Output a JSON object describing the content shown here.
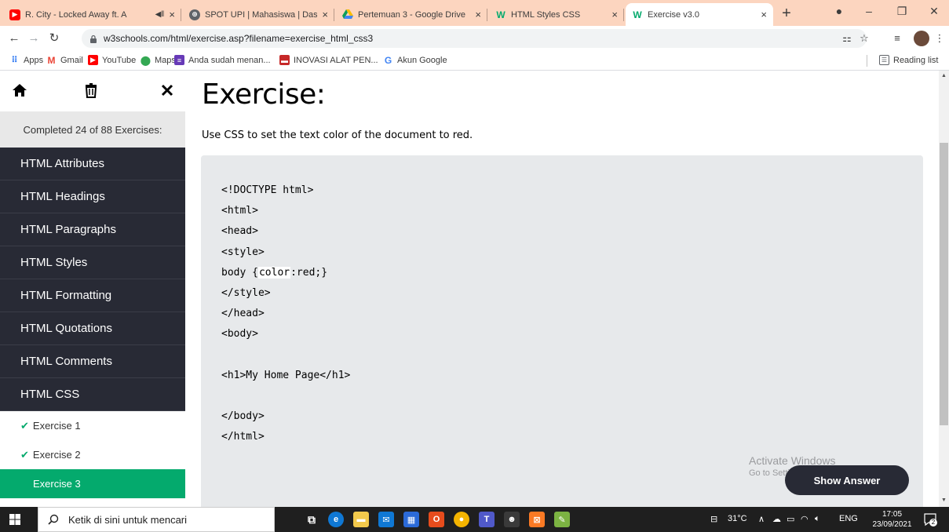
{
  "browser": {
    "tabs": [
      {
        "title": "R. City - Locked Away ft. A",
        "icon": "youtube-icon",
        "close": "×"
      },
      {
        "title": "SPOT UPI | Mahasiswa | Dashb",
        "icon": "globe-icon",
        "close": "×"
      },
      {
        "title": "Pertemuan 3 - Google Drive",
        "icon": "drive-icon",
        "close": "×"
      },
      {
        "title": "HTML Styles CSS",
        "icon": "w3schools-icon",
        "close": "×"
      },
      {
        "title": "Exercise v3.0",
        "icon": "w3schools-icon",
        "close": "×",
        "active": true
      }
    ],
    "new_tab": "+",
    "url": "w3schools.com/html/exercise.asp?filename=exercise_html_css3",
    "bookmarks": [
      {
        "label": "Apps",
        "icon": "apps-grid-icon"
      },
      {
        "label": "Gmail",
        "icon": "gmail-icon"
      },
      {
        "label": "YouTube",
        "icon": "youtube-icon"
      },
      {
        "label": "Maps",
        "icon": "maps-icon"
      },
      {
        "label": "Anda sudah menan...",
        "icon": "forms-icon"
      },
      {
        "label": "INOVASI ALAT PEN...",
        "icon": "folder-icon"
      },
      {
        "label": "Akun Google",
        "icon": "google-icon"
      }
    ],
    "reading_list": "Reading list"
  },
  "sidebar": {
    "progress": "Completed 24 of 88 Exercises:",
    "sections": [
      {
        "label": "HTML Attributes"
      },
      {
        "label": "HTML Headings"
      },
      {
        "label": "HTML Paragraphs"
      },
      {
        "label": "HTML Styles"
      },
      {
        "label": "HTML Formatting"
      },
      {
        "label": "HTML Quotations"
      },
      {
        "label": "HTML Comments"
      },
      {
        "label": "HTML CSS"
      }
    ],
    "exercises": [
      {
        "label": "Exercise 1",
        "completed": true
      },
      {
        "label": "Exercise 2",
        "completed": true
      },
      {
        "label": "Exercise 3",
        "completed": false,
        "active": true
      }
    ]
  },
  "main": {
    "title": "Exercise:",
    "instruction": "Use CSS to set the text color of the document to red.",
    "code": {
      "l1": "<!DOCTYPE html>",
      "l2": "<html>",
      "l3": "<head>",
      "l4": "<style>",
      "l5_pre": "body {",
      "l5_answer": "color",
      "l5_post": ":red;}",
      "l6": "</style>",
      "l7": "</head>",
      "l8": "<body>",
      "l9": "<h1>My Home Page</h1>",
      "l10": "</body>",
      "l11": "</html>"
    },
    "show_answer": "Show Answer",
    "watermark_title": "Activate Windows",
    "watermark_sub": "Go to Settings to activate Windows."
  },
  "taskbar": {
    "search_placeholder": "Ketik di sini untuk mencari",
    "weather": "31°C",
    "language": "ENG",
    "time": "17:05",
    "date": "23/09/2021",
    "notifications": "2"
  },
  "colors": {
    "tabstrip": "#fcd5bf",
    "sidebar_dark": "#282a35",
    "accent_green": "#04aa6d",
    "code_bg": "#e7e9eb"
  }
}
